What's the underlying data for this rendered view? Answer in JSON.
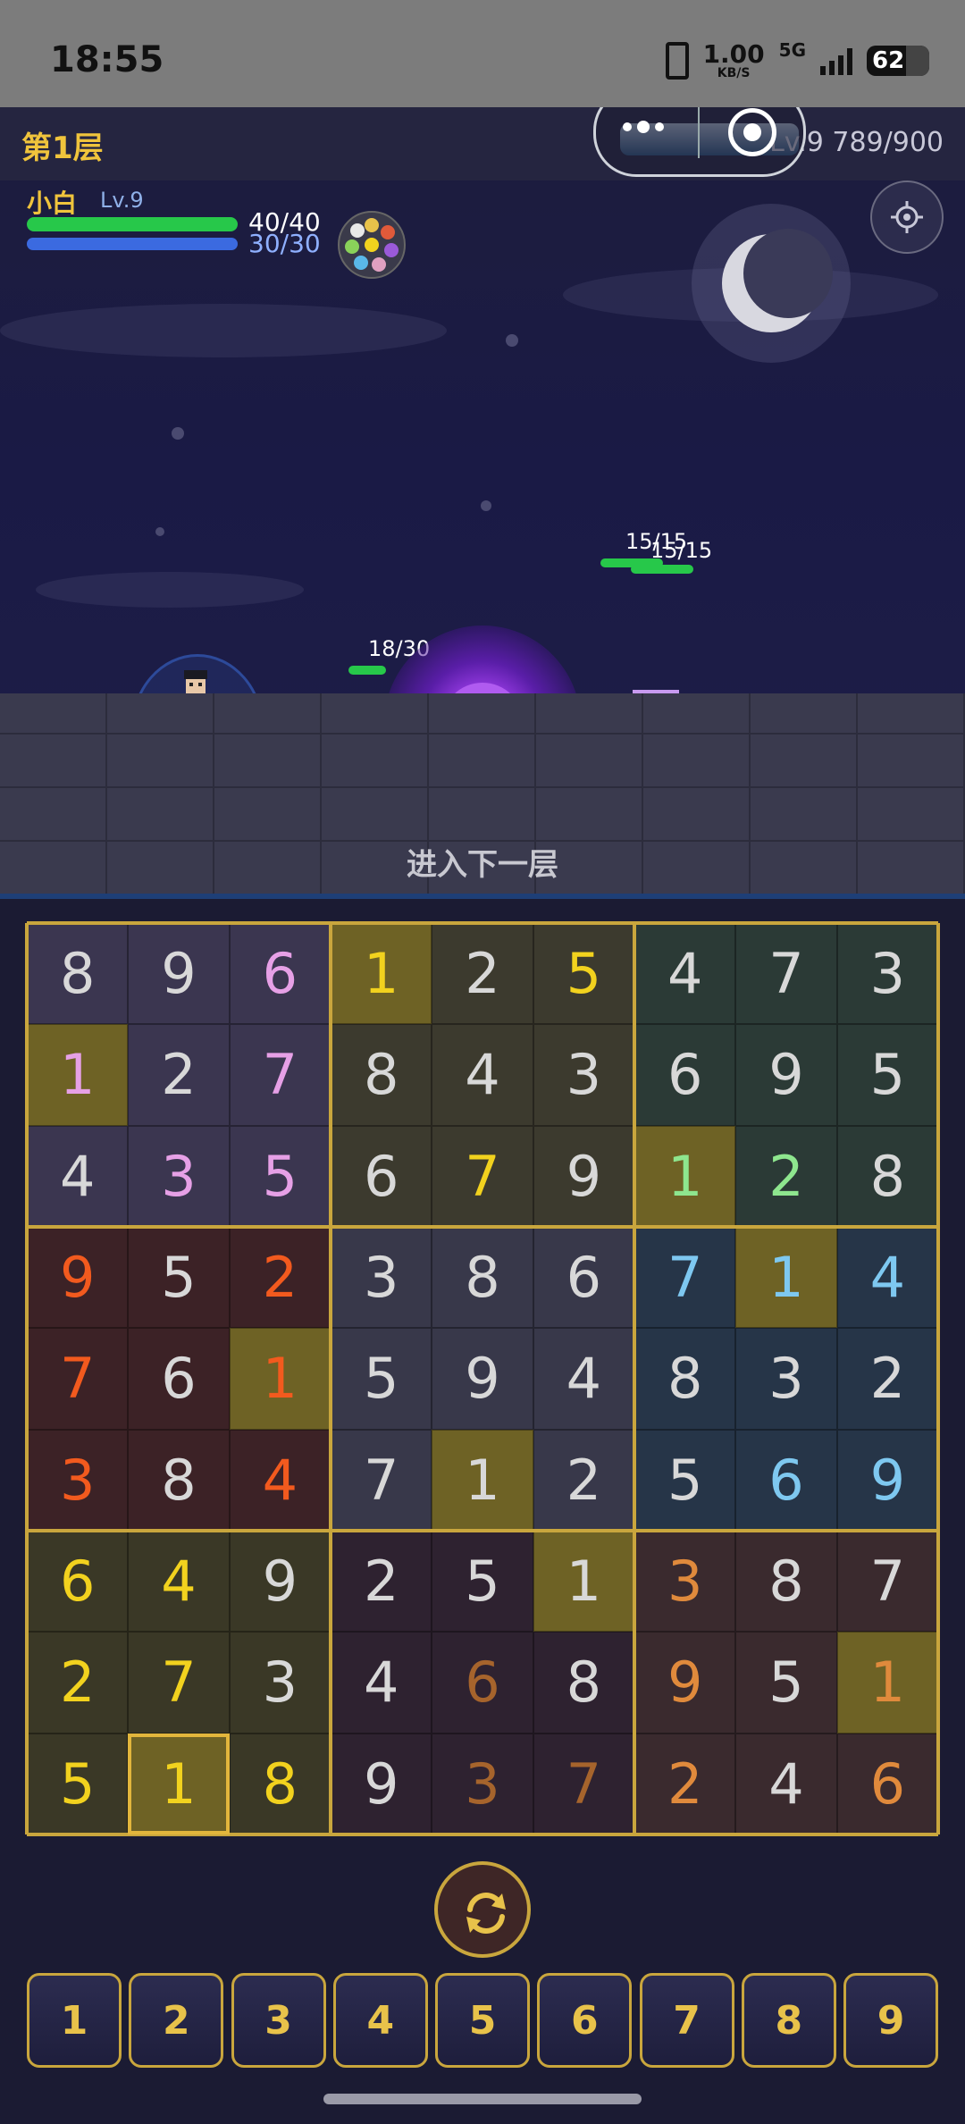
{
  "status_bar": {
    "time": "18:55",
    "speed_value": "1.00",
    "speed_unit": "KB/S",
    "network": "5G",
    "battery": "62",
    "battery_level": 0.62
  },
  "header": {
    "floor_title": "第1层",
    "level_text": "Lv.9 789/900",
    "xp_fraction": 0.877
  },
  "player": {
    "name": "小白",
    "level": "Lv.9",
    "hp_text": "40/40",
    "mp_text": "30/30",
    "hp_fraction": 1.0,
    "mp_fraction": 1.0
  },
  "enemies": [
    {
      "hp_text": "18/30",
      "hp_fraction": 0.6
    },
    {
      "hp_text": "15/15",
      "hp_fraction": 1.0
    },
    {
      "hp_text": "15/15",
      "hp_fraction": 1.0
    }
  ],
  "next_floor_label": "进入下一层",
  "icons": {
    "settings": "gear-icon",
    "refresh": "refresh-icon",
    "moon": "moon-icon"
  },
  "colors": {
    "accent_gold": "#e8c24a",
    "block_bg": [
      [
        "#3b3650",
        "#3c3a2e",
        "#2b3a36"
      ],
      [
        "#3c2226",
        "#38384a",
        "#263548"
      ],
      [
        "#3a3826",
        "#2e2230",
        "#3a2a2e"
      ]
    ],
    "highlight_bg": "#6e6225",
    "text": {
      "w": "#d8d8d8",
      "p": "#e6a0e6",
      "y": "#f2d21e",
      "g": "#8ee68e",
      "r": "#f25a1e",
      "b": "#7ec8f0",
      "o": "#e08a3c",
      "d": "#a6642c"
    }
  },
  "board": {
    "values": [
      [
        8,
        9,
        6,
        1,
        2,
        5,
        4,
        7,
        3
      ],
      [
        1,
        2,
        7,
        8,
        4,
        3,
        6,
        9,
        5
      ],
      [
        4,
        3,
        5,
        6,
        7,
        9,
        1,
        2,
        8
      ],
      [
        9,
        5,
        2,
        3,
        8,
        6,
        7,
        1,
        4
      ],
      [
        7,
        6,
        1,
        5,
        9,
        4,
        8,
        3,
        2
      ],
      [
        3,
        8,
        4,
        7,
        1,
        2,
        5,
        6,
        9
      ],
      [
        6,
        4,
        9,
        2,
        5,
        1,
        3,
        8,
        7
      ],
      [
        2,
        7,
        3,
        4,
        6,
        8,
        9,
        5,
        1
      ],
      [
        5,
        1,
        8,
        9,
        3,
        7,
        2,
        4,
        6
      ]
    ],
    "colors": [
      [
        "w",
        "w",
        "p",
        "y",
        "w",
        "y",
        "w",
        "w",
        "w"
      ],
      [
        "p",
        "w",
        "p",
        "w",
        "w",
        "w",
        "w",
        "w",
        "w"
      ],
      [
        "w",
        "p",
        "p",
        "w",
        "y",
        "w",
        "g",
        "g",
        "w"
      ],
      [
        "r",
        "w",
        "r",
        "w",
        "w",
        "w",
        "b",
        "b",
        "b"
      ],
      [
        "r",
        "w",
        "r",
        "w",
        "w",
        "w",
        "w",
        "w",
        "w"
      ],
      [
        "r",
        "w",
        "r",
        "w",
        "w",
        "w",
        "w",
        "b",
        "b"
      ],
      [
        "y",
        "y",
        "w",
        "w",
        "w",
        "w",
        "o",
        "w",
        "w"
      ],
      [
        "y",
        "y",
        "w",
        "w",
        "d",
        "w",
        "o",
        "w",
        "o"
      ],
      [
        "y",
        "y",
        "y",
        "w",
        "d",
        "d",
        "o",
        "w",
        "o"
      ]
    ],
    "highlighted": [
      [
        0,
        3
      ],
      [
        1,
        0
      ],
      [
        2,
        6
      ],
      [
        3,
        7
      ],
      [
        4,
        2
      ],
      [
        5,
        4
      ],
      [
        6,
        5
      ],
      [
        7,
        8
      ],
      [
        8,
        1
      ]
    ],
    "selected": [
      8,
      1
    ]
  },
  "numpad": [
    "1",
    "2",
    "3",
    "4",
    "5",
    "6",
    "7",
    "8",
    "9"
  ]
}
